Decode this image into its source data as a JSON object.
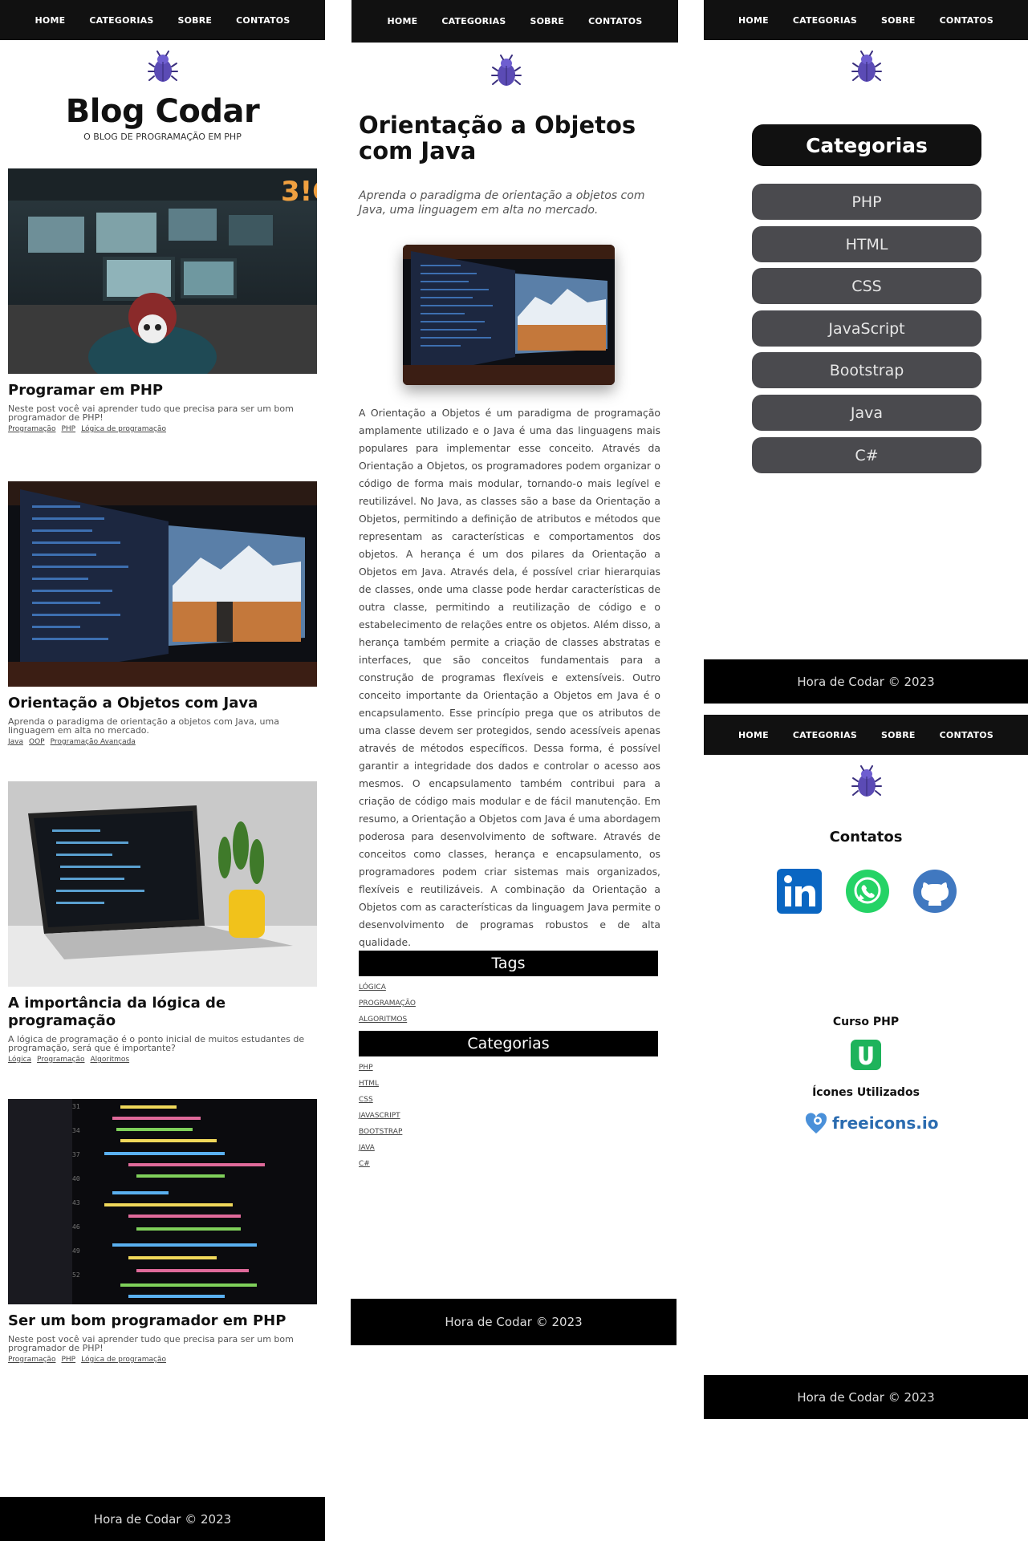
{
  "nav": {
    "home": "HOME",
    "categorias": "CATEGORIAS",
    "sobre": "SOBRE",
    "contatos": "CONTATOS"
  },
  "footer": {
    "text": "Hora de Codar © 2023"
  },
  "blog": {
    "title": "Blog Codar",
    "subtitle": "O BLOG DE PROGRAMAÇÃO EM PHP",
    "posts": [
      {
        "title": "Programar em PHP",
        "excerpt": "Neste post você vai aprender tudo que precisa para ser um bom programador de PHP!",
        "tags": [
          "Programação",
          "PHP",
          "Lógica de programação"
        ]
      },
      {
        "title": "Orientação a Objetos com Java",
        "excerpt": "Aprenda o paradigma de orientação a objetos com Java, uma linguagem em alta no mercado.",
        "tags": [
          "Java",
          "OOP",
          "Programação Avançada"
        ]
      },
      {
        "title": "A importância da lógica de programação",
        "excerpt": "A lógica de programação é o ponto inicial de muitos estudantes de programação, será que é importante?",
        "tags": [
          "Lógica",
          "Programação",
          "Algoritmos"
        ]
      },
      {
        "title": "Ser um bom programador em PHP",
        "excerpt": "Neste post você vai aprender tudo que precisa para ser um bom programador de PHP!",
        "tags": [
          "Programação",
          "PHP",
          "Lógica de programação"
        ]
      }
    ]
  },
  "article": {
    "title": "Orientação a Objetos com Java",
    "subtitle": "Aprenda o paradigma de orientação a objetos com Java, uma linguagem em alta no mercado.",
    "body": "A Orientação a Objetos é um paradigma de programação amplamente utilizado e o Java é uma das linguagens mais populares para implementar esse conceito. Através da Orientação a Objetos, os programadores podem organizar o código de forma mais modular, tornando-o mais legível e reutilizável. No Java, as classes são a base da Orientação a Objetos, permitindo a definição de atributos e métodos que representam as características e comportamentos dos objetos. A herança é um dos pilares da Orientação a Objetos em Java. Através dela, é possível criar hierarquias de classes, onde uma classe pode herdar características de outra classe, permitindo a reutilização de código e o estabelecimento de relações entre os objetos. Além disso, a herança também permite a criação de classes abstratas e interfaces, que são conceitos fundamentais para a construção de programas flexíveis e extensíveis. Outro conceito importante da Orientação a Objetos em Java é o encapsulamento. Esse princípio prega que os atributos de uma classe devem ser protegidos, sendo acessíveis apenas através de métodos específicos. Dessa forma, é possível garantir a integridade dos dados e controlar o acesso aos mesmos. O encapsulamento também contribui para a criação de código mais modular e de fácil manutenção. Em resumo, a Orientação a Objetos com Java é uma abordagem poderosa para desenvolvimento de software. Através de conceitos como classes, herança e encapsulamento, os programadores podem criar sistemas mais organizados, flexíveis e reutilizáveis. A combinação da Orientação a Objetos com as características da linguagem Java permite o desenvolvimento de programas robustos e de alta qualidade.",
    "tags_heading": "Tags",
    "tags": [
      "LÓGICA",
      "PROGRAMAÇÃO",
      "ALGORITMOS"
    ],
    "categories_heading": "Categorias",
    "categories": [
      "PHP",
      "HTML",
      "CSS",
      "JAVASCRIPT",
      "BOOTSTRAP",
      "JAVA",
      "C#"
    ]
  },
  "categories_page": {
    "heading": "Categorias",
    "items": [
      "PHP",
      "HTML",
      "CSS",
      "JavaScript",
      "Bootstrap",
      "Java",
      "C#"
    ]
  },
  "contacts_page": {
    "heading": "Contatos",
    "socials": [
      "linkedin-icon",
      "whatsapp-icon",
      "github-icon"
    ],
    "course_heading": "Curso PHP",
    "icons_heading": "Ícones Utilizados",
    "freeicons_label": "freeicons.io"
  },
  "colors": {
    "nav": "#111111",
    "accent_bug": "#5b4bb5",
    "cat_button": "#4a4a4e",
    "linkedin": "#0a66c2",
    "whatsapp": "#25d366",
    "github": "#4078c0",
    "udemy_green": "#1eb35b"
  }
}
